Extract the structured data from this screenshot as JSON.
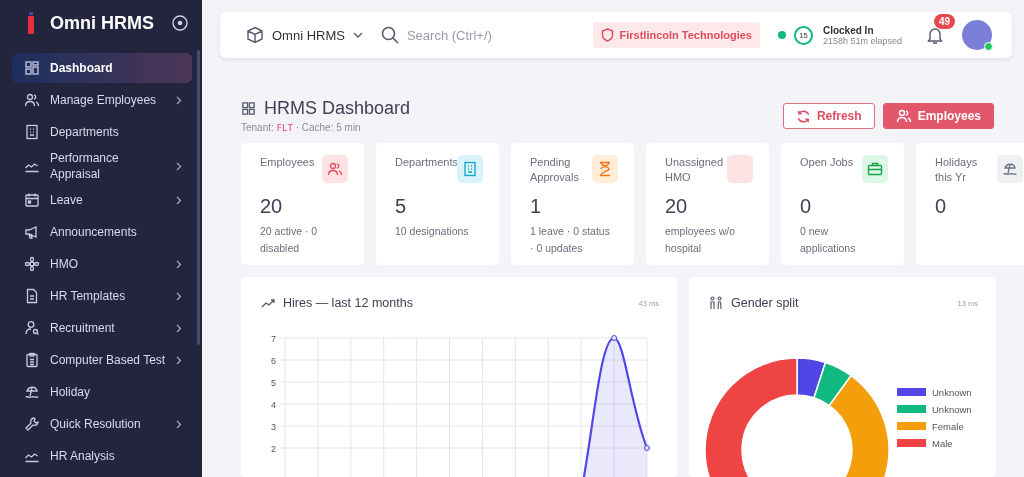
{
  "sidebar": {
    "brand": "Omni HRMS",
    "items": [
      {
        "label": "Dashboard",
        "selected": true,
        "has_submenu": false
      },
      {
        "label": "Manage Employees",
        "selected": false,
        "has_submenu": true
      },
      {
        "label": "Departments",
        "selected": false,
        "has_submenu": false
      },
      {
        "label": "Performance Appraisal",
        "selected": false,
        "has_submenu": true
      },
      {
        "label": "Leave",
        "selected": false,
        "has_submenu": true
      },
      {
        "label": "Announcements",
        "selected": false,
        "has_submenu": false
      },
      {
        "label": "HMO",
        "selected": false,
        "has_submenu": true
      },
      {
        "label": "HR Templates",
        "selected": false,
        "has_submenu": true
      },
      {
        "label": "Recruitment",
        "selected": false,
        "has_submenu": true
      },
      {
        "label": "Computer Based Test",
        "selected": false,
        "has_submenu": true
      },
      {
        "label": "Holiday",
        "selected": false,
        "has_submenu": false
      },
      {
        "label": "Quick Resolution",
        "selected": false,
        "has_submenu": true
      },
      {
        "label": "HR Analysis",
        "selected": false,
        "has_submenu": false
      }
    ]
  },
  "topbar": {
    "workspace": "Omni HRMS",
    "search": {
      "placeholder": "Search (Ctrl+/)"
    },
    "company": "Firstlincoln Technologies",
    "clock": {
      "count": "15",
      "status": "Clocked In",
      "elapsed": "2158h 51m elapsed"
    },
    "notifications": "49"
  },
  "header": {
    "title": "HRMS Dashboard",
    "tenant_label": "Tenant:",
    "tenant_code": "FLT",
    "cache": "· Cache: 5 min",
    "buttons": [
      {
        "label": "Refresh",
        "kind": "outline"
      },
      {
        "label": "Employees",
        "kind": "primary"
      }
    ]
  },
  "stats": [
    {
      "label": "Employees",
      "value": "20",
      "detail": "20 active · 0 disabled",
      "color": "#fde2e4"
    },
    {
      "label": "Departments",
      "value": "5",
      "detail": "10 designations",
      "color": "#d9f3fb"
    },
    {
      "label": "Pending Approvals",
      "value": "1",
      "detail": "1 leave · 0 status · 0 updates",
      "color": "#ffedd9"
    },
    {
      "label": "Unassigned HMO",
      "value": "20",
      "detail": "employees w/o hospital",
      "color": "#fde2e4"
    },
    {
      "label": "Open Jobs",
      "value": "0",
      "detail": "0 new applications",
      "color": "#dcf7e6"
    },
    {
      "label": "Holidays this Yr",
      "value": "0",
      "color": "#eef0f1"
    }
  ],
  "hires": {
    "title": "Hires — last 12 months",
    "timing": "43 ms",
    "y_axis_labels": [
      "7",
      "6",
      "5",
      "4",
      "3",
      "2"
    ]
  },
  "gender": {
    "title": "Gender split",
    "timing": "13 ms",
    "chart_data": {
      "type": "donut",
      "values": [
        5,
        5,
        40,
        50
      ]
    },
    "legend": [
      {
        "label": "Unknown",
        "color": "#4f46e5"
      },
      {
        "label": "Unknown",
        "color": "#10b981"
      },
      {
        "label": "Female",
        "color": "#f59e0b"
      },
      {
        "label": "Male",
        "color": "#ef4444"
      }
    ]
  }
}
